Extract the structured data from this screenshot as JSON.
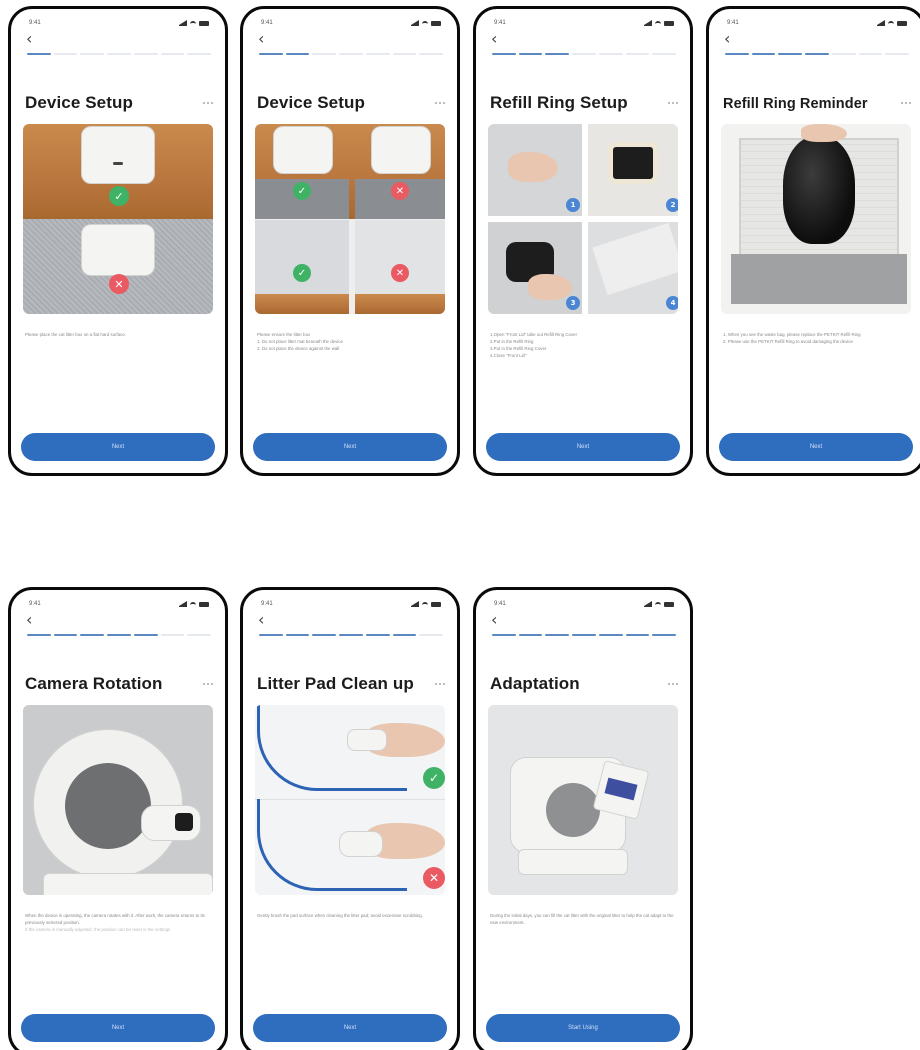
{
  "status": {
    "time": "9:41"
  },
  "common": {
    "back_glyph": "‹",
    "next_label": "Next"
  },
  "accent_color": "#2f6dbf",
  "screens": [
    {
      "title": "Device Setup",
      "desc": [
        "Please place the cat litter box on a flat hard surface."
      ],
      "button": "Next",
      "icons": [
        "check-icon",
        "cross-icon"
      ]
    },
    {
      "title": "Device Setup",
      "desc": [
        "Please ensure the litter box",
        "1. Do not place litter mat beneath the device",
        "2. Do not place the device against the wall"
      ],
      "button": "Next",
      "icons": [
        "check-icon",
        "cross-icon",
        "check-icon",
        "cross-icon"
      ]
    },
    {
      "title": "Refill Ring Setup",
      "desc": [
        "1.Open \"Front Lid\" take out Refill Ring Cover",
        "2.Put in the Refill Ring",
        "3.Put in the Refill Ring Cover",
        "4.Close \"Front Lid\""
      ],
      "button": "Next",
      "steps": [
        "1",
        "2",
        "3",
        "4"
      ]
    },
    {
      "title": "Refill Ring Reminder",
      "desc": [
        "1. When you see the waste bag, please replace the PETKIT Refill Ring",
        "2. Please use the PETKIT Refill Ring to avoid damaging the device"
      ],
      "button": "Next"
    },
    {
      "title": "Camera Rotation",
      "desc": [
        "When the device is operating, the camera rotates with it. After work, the camera returns to its previously selected position.",
        "If the camera is manually adjusted, the position can be reset in the settings"
      ],
      "button": "Next"
    },
    {
      "title": "Litter Pad Clean up",
      "desc": [
        "Gently brush the pad surface when cleaning the litter pad; avoid excessive scrubbing."
      ],
      "button": "Next",
      "icons": [
        "check-icon",
        "cross-icon"
      ]
    },
    {
      "title": "Adaptation",
      "desc": [
        "During the initial days, you can fill the cat litter with the original litter to help the cat adapt to the new environment."
      ],
      "button": "Start Using"
    }
  ]
}
